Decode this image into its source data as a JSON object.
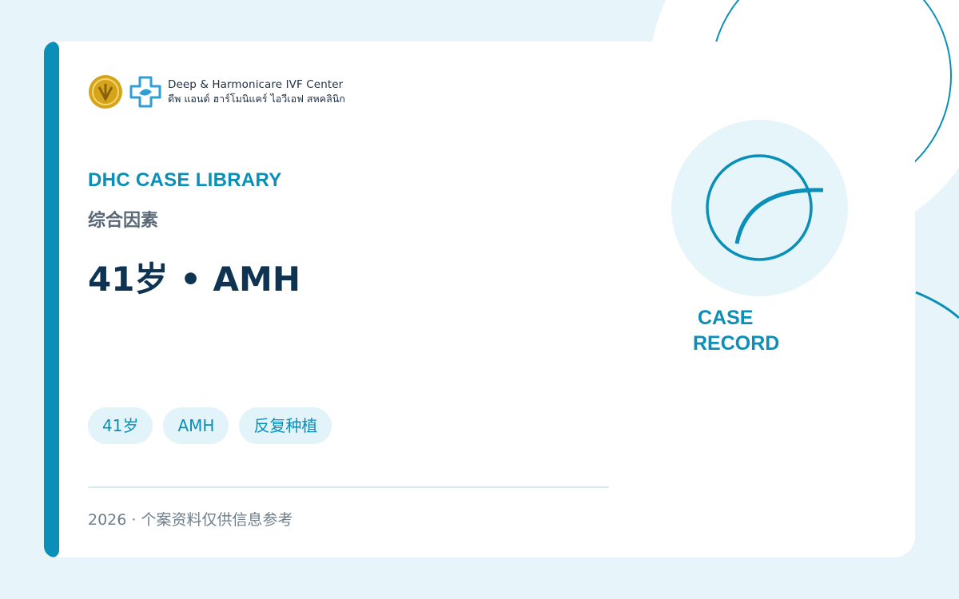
{
  "brand": {
    "name_en": "Deep & Harmonicare IVF Center",
    "name_th": "ดีพ แอนด์ ฮาร์โมนิแคร์ ไอวีเอฟ สหคลินิก",
    "accent_color": "#0a8fb8",
    "seal_color": "#d6a41c"
  },
  "header": {
    "eyebrow": "DHC CASE LIBRARY",
    "subtitle": "综合因素",
    "headline": "41岁 • AMH"
  },
  "tags": [
    "41岁",
    "AMH",
    "反复种植"
  ],
  "footer": {
    "text": "2026 · 个案资料仅供信息参考"
  },
  "badge": {
    "line1": "CASE",
    "line2": "RECORD",
    "icon": "record-ring-icon"
  }
}
